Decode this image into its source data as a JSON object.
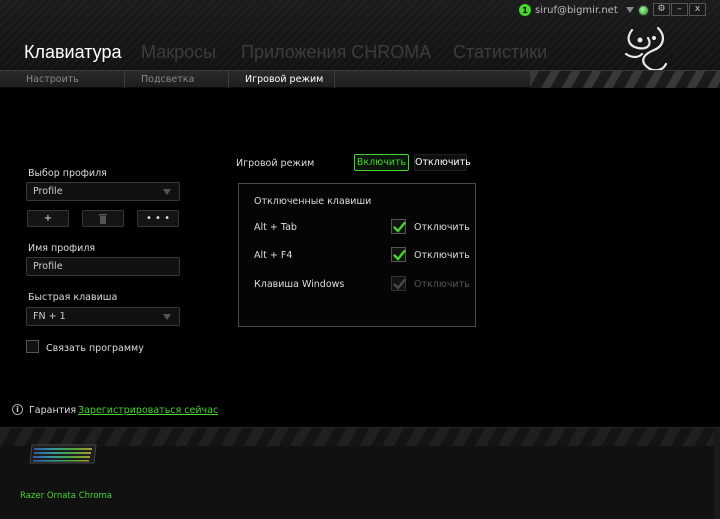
{
  "account": {
    "notifications": "1",
    "email": "siruf@bigmir.net"
  },
  "window_controls": {
    "settings": "⚙",
    "minimize": "–",
    "close": "x"
  },
  "main_tabs": [
    {
      "label": "Клавиатура",
      "active": true
    },
    {
      "label": "Макросы",
      "active": false
    },
    {
      "label": "Приложения CHROMA",
      "active": false
    },
    {
      "label": "Статистики",
      "active": false
    }
  ],
  "sub_tabs": [
    {
      "label": "Настроить",
      "active": false
    },
    {
      "label": "Подсветка",
      "active": false
    },
    {
      "label": "Игровой режим",
      "active": true
    }
  ],
  "profile": {
    "select_label": "Выбор профиля",
    "selected": "Profile",
    "add_button": "+",
    "delete_button": "",
    "more_button": "• • •",
    "name_label": "Имя профиля",
    "name_value": "Profile",
    "hotkey_label": "Быстрая клавиша",
    "hotkey_value": "FN + 1",
    "link_program_label": "Связать программу"
  },
  "warranty": {
    "label": "Гарантия",
    "link": "Зарегистрироваться сейчас"
  },
  "game_mode": {
    "label": "Игровой режим",
    "on_label": "Включить",
    "off_label": "Отключить",
    "state": "on",
    "disabled_keys_title": "Отключенные клавиши",
    "keys": [
      {
        "name": "Alt + Tab",
        "toggle_label": "Отключить",
        "checked": true,
        "enabled": true
      },
      {
        "name": "Alt + F4",
        "toggle_label": "Отключить",
        "checked": true,
        "enabled": true
      },
      {
        "name": "Клавиша Windows",
        "toggle_label": "Отключить",
        "checked": true,
        "enabled": false
      }
    ]
  },
  "device": {
    "name": "Razer Ornata Chroma"
  },
  "colors": {
    "accent": "#44d62c",
    "background": "#000000"
  }
}
